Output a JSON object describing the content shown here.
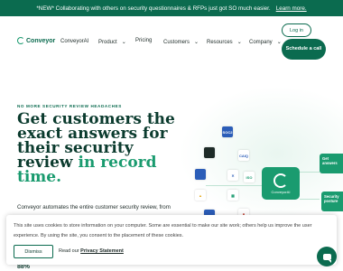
{
  "banner": {
    "text": "*NEW* Collaborating with others on security questionnaires & RFPs just got SO much easier.",
    "link": "Learn more."
  },
  "nav": {
    "logo": "Conveyor",
    "items": [
      "ConveyorAI",
      "Product",
      "Pricing",
      "Customers",
      "Resources",
      "Company"
    ],
    "login": "Log in",
    "demo": "Schedule a call"
  },
  "hero": {
    "eyebrow": "NO MORE SECURITY REVIEW HEADACHES",
    "headline_main": "Get customers the exact answers for their security review",
    "headline_accent": "in record time.",
    "subtext": "Conveyor automates the entire customer security review, from",
    "stat": "88%"
  },
  "art": {
    "tiles": [
      "SOC2",
      "CAIQ",
      "ISO"
    ],
    "hub_label": "ConveyorAI",
    "card1": "Get answers",
    "card2": "Security posture"
  },
  "cookie": {
    "text": "This site uses cookies to store information on your computer. Some are essential to make our site work; others help us improve the user experience. By using the site, you consent to the placement of these cookies.",
    "dismiss": "Dismiss",
    "read_our": "Read our",
    "privacy_link": "Privacy Statement"
  },
  "colors": {
    "brand": "#0b6b4f",
    "accent": "#1a9b6f"
  }
}
